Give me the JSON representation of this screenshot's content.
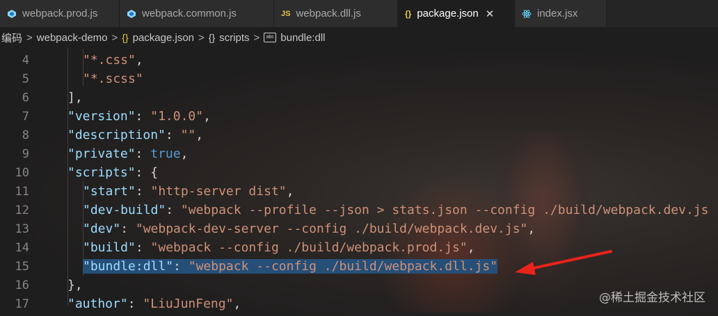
{
  "tabs": [
    {
      "label": "webpack.prod.js",
      "icon": "webpack-icon",
      "active": false
    },
    {
      "label": "webpack.common.js",
      "icon": "webpack-icon",
      "active": false
    },
    {
      "label": "webpack.dll.js",
      "icon": "js-icon",
      "active": false
    },
    {
      "label": "package.json",
      "icon": "json-icon",
      "active": true
    },
    {
      "label": "index.jsx",
      "icon": "react-icon",
      "active": false
    }
  ],
  "tab_close_glyph": "✕",
  "breadcrumb": {
    "items": [
      "编码",
      "webpack-demo",
      "package.json",
      "scripts",
      "bundle:dll"
    ],
    "json_glyph": "{}",
    "scripts_glyph": "{}",
    "abc_glyph": "abc",
    "sep": ">"
  },
  "editor": {
    "lines": [
      {
        "n": "4"
      },
      {
        "n": "5"
      },
      {
        "n": "6"
      },
      {
        "n": "7"
      },
      {
        "n": "8"
      },
      {
        "n": "9"
      },
      {
        "n": "10"
      },
      {
        "n": "11"
      },
      {
        "n": "12"
      },
      {
        "n": "13"
      },
      {
        "n": "14"
      },
      {
        "n": "15"
      },
      {
        "n": "16"
      },
      {
        "n": "17"
      }
    ],
    "tokens": {
      "l4_str": "\"*.css\"",
      "l5_str": "\"*.scss\"",
      "l6": "],",
      "l7_key": "\"version\"",
      "l7_val": "\"1.0.0\"",
      "l8_key": "\"description\"",
      "l8_val": "\"\"",
      "l9_key": "\"private\"",
      "l9_val": "true",
      "l10_key": "\"scripts\"",
      "l10_brace": "{",
      "l11_key": "\"start\"",
      "l11_val": "\"http-server dist\"",
      "l12_key": "\"dev-build\"",
      "l12_val": "\"webpack --profile --json > stats.json --config ./build/webpack.dev.js",
      "l13_key": "\"dev\"",
      "l13_val": "\"webpack-dev-server --config ./build/webpack.dev.js\"",
      "l14_key": "\"build\"",
      "l14_val": "\"webpack --config ./build/webpack.prod.js\"",
      "l15_key": "\"bundle:dll\"",
      "l15_val": "\"webpack --config ./build/webpack.dll.js\"",
      "l16": "},",
      "l17_key": "\"author\"",
      "l17_val": "\"LiuJunFeng\""
    },
    "colon": ": ",
    "comma": ","
  },
  "watermark": "@稀土掘金技术社区",
  "colors": {
    "arrow": "#e8231a",
    "selection": "#264f78",
    "key": "#9cdcfe",
    "string": "#ce9178",
    "boolean": "#569cd6"
  }
}
